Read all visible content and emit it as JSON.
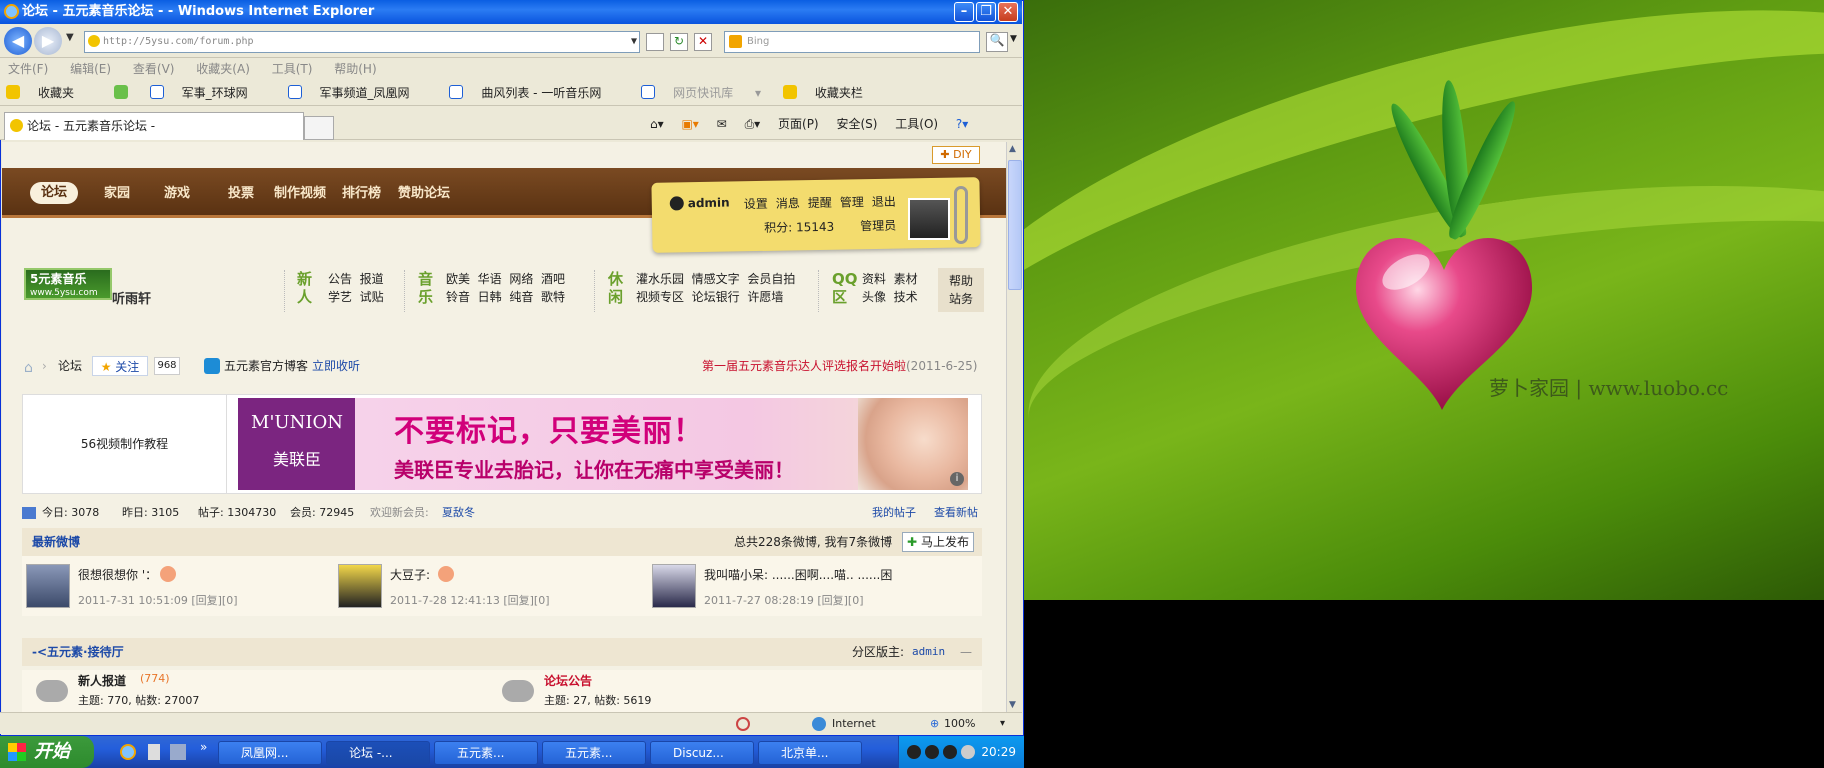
{
  "window": {
    "title": "论坛 - 五元素音乐论坛 - - Windows Internet Explorer"
  },
  "address": {
    "url": "http://5ysu.com/forum.php",
    "search_placeholder": "Bing"
  },
  "menu": [
    "文件(F)",
    "编辑(E)",
    "查看(V)",
    "收藏夹(A)",
    "工具(T)",
    "帮助(H)"
  ],
  "favorites": {
    "label": "收藏夹",
    "links": [
      "军事_环球网",
      "军事频道_凤凰网",
      "曲风列表 - 一听音乐网",
      "网页快讯库",
      "收藏夹栏"
    ]
  },
  "tab": {
    "active_title": "论坛 - 五元素音乐论坛 -"
  },
  "commandbar": [
    "页面(P)",
    "安全(S)",
    "工具(O)"
  ],
  "site": {
    "diy": "DIY",
    "nav": [
      "论坛",
      "家园",
      "游戏",
      "投票",
      "制作视频",
      "排行榜",
      "赞助论坛"
    ],
    "user": {
      "name": "admin",
      "links": [
        "设置",
        "消息",
        "提醒",
        "管理",
        "退出"
      ],
      "points_label": "积分: 15143",
      "role": "管理员"
    },
    "logo_line1": "5元素音乐",
    "logo_line2": "www.5ysu.com",
    "logo_suffix": "听雨轩",
    "categories": [
      {
        "lead": "新人",
        "row1": [
          "公告",
          "报道"
        ],
        "row2": [
          "学艺",
          "试贴"
        ]
      },
      {
        "lead": "音乐",
        "row1": [
          "欧美",
          "华语",
          "网络",
          "酒吧"
        ],
        "row2": [
          "铃音",
          "日韩",
          "纯音",
          "歌特"
        ]
      },
      {
        "lead": "休闲",
        "row1": [
          "灌水乐园",
          "情感文字",
          "会员自拍"
        ],
        "row2": [
          "视频专区",
          "论坛银行",
          "许愿墙"
        ]
      },
      {
        "lead": "QQ区",
        "row1": [
          "资料",
          "素材"
        ],
        "row2": [
          "头像",
          "技术"
        ]
      }
    ],
    "help": [
      "帮助",
      "站务"
    ],
    "breadcrumb": {
      "current": "论坛",
      "follow": "关注",
      "follow_count": "968",
      "blog": "五元素官方博客",
      "blog_link": "立即收听",
      "notice": "第一届五元素音乐达人评选报名开始啦",
      "notice_date": "(2011-6-25)"
    },
    "ad_left": "56视频制作教程",
    "ad": {
      "brand": "M'UNION",
      "brand_cn": "美联臣",
      "headline": "不要标记，只要美丽！",
      "subline": "美联臣专业去胎记，让你在无痛中享受美丽！"
    },
    "stats": {
      "today": "今日: 3078",
      "yesterday": "昨日: 3105",
      "posts": "帖子: 1304730",
      "members": "会员: 72945",
      "welcome": "欢迎新会员:",
      "newest": "夏敌冬",
      "my_posts": "我的帖子",
      "new_posts": "查看新帖"
    },
    "weibo": {
      "title": "最新微博",
      "summary": "总共228条微博, 我有7条微博",
      "publish": "马上发布",
      "items": [
        {
          "text": "很想很想你 '：",
          "meta": "2011-7-31 10:51:09 [回复][0]"
        },
        {
          "text": "大豆子:",
          "meta": "2011-7-28 12:41:13 [回复][0]"
        },
        {
          "text": "我叫喵小呆: ......困啊....喵.. ......困",
          "meta": "2011-7-27 08:28:19 [回复][0]"
        }
      ]
    },
    "zone": {
      "title": "-<五元素·接待厅",
      "moderator_label": "分区版主:",
      "moderator": "admin"
    },
    "forums": [
      {
        "name": "新人报道",
        "count": "(774)",
        "stats": "主题: 770, 帖数: 27007"
      },
      {
        "name": "论坛公告",
        "stats": "主题: 27, 帖数: 5619"
      }
    ]
  },
  "status": {
    "zone": "Internet",
    "zoom": "100%"
  },
  "taskbar": {
    "start": "开始",
    "tasks": [
      "凤凰网...",
      "论坛 -...",
      "五元素...",
      "五元素...",
      "Discuz...",
      "北京单..."
    ],
    "clock": "20:29"
  },
  "desktop": {
    "brand": "萝卜家园 | www.luobo.cc"
  },
  "colors": {
    "xp_blue": "#0a5ee2",
    "nav_brown": "#6a3e1a",
    "accent_green": "#6aa02c",
    "notice_red": "#c8102e"
  }
}
